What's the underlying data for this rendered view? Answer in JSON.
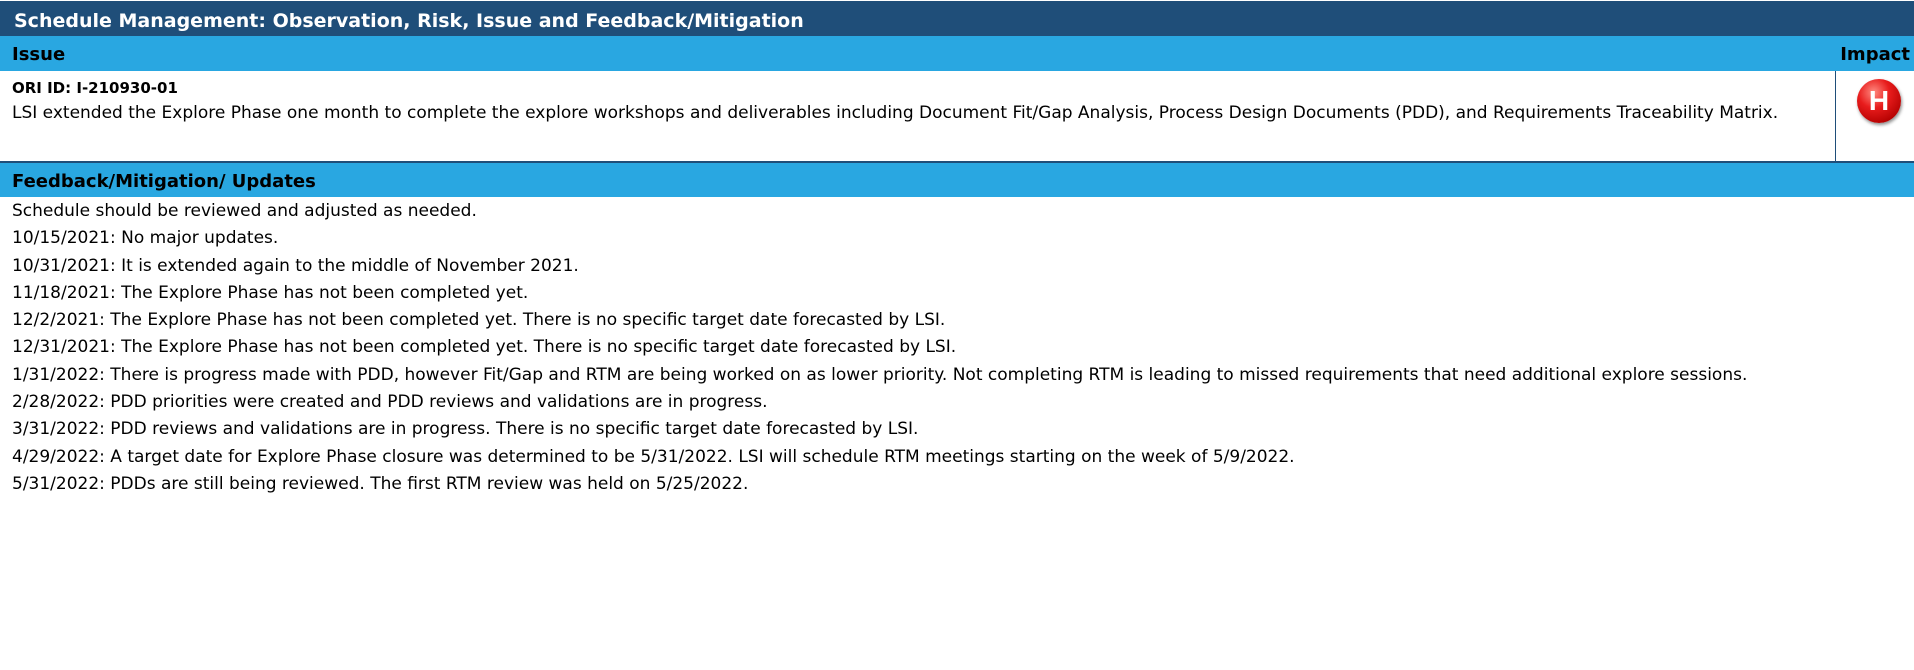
{
  "title": "Schedule Management: Observation, Risk, Issue and Feedback/Mitigation",
  "issue_section": {
    "header_left": "Issue",
    "header_right": "Impact",
    "ori_id": "ORI ID: I-210930-01",
    "description": "LSI extended the Explore Phase one month to complete the explore workshops and deliverables including Document Fit/Gap Analysis, Process Design Documents (PDD), and Requirements Traceability Matrix.",
    "impact_level": "H",
    "impact_color": "#e81c1c"
  },
  "feedback_section": {
    "header": "Feedback/Mitigation/ Updates",
    "lines": [
      "Schedule should be reviewed and adjusted as needed.",
      "10/15/2021: No major updates.",
      "10/31/2021: It is extended again to the middle of November 2021.",
      "11/18/2021: The Explore Phase has not been completed yet.",
      "12/2/2021: The Explore Phase has not been completed yet.  There is no specific target date forecasted by LSI.",
      "12/31/2021: The Explore Phase has not been completed yet.  There is no specific target date forecasted by LSI.",
      "1/31/2022: There is progress made with PDD, however Fit/Gap and RTM are being worked on as lower priority.  Not completing RTM is leading to missed requirements that need additional explore sessions.",
      "2/28/2022: PDD priorities were created and PDD reviews and validations are in progress.",
      "3/31/2022: PDD reviews and validations are in progress. There is no specific target date forecasted by LSI.",
      "4/29/2022: A target date for Explore Phase closure was determined to be 5/31/2022. LSI will schedule RTM meetings starting on the week of 5/9/2022.",
      "5/31/2022: PDDs are still being reviewed. The first RTM review was held on 5/25/2022."
    ]
  },
  "colors": {
    "title_bg": "#1f4e79",
    "section_header_bg": "#29a7e1"
  }
}
